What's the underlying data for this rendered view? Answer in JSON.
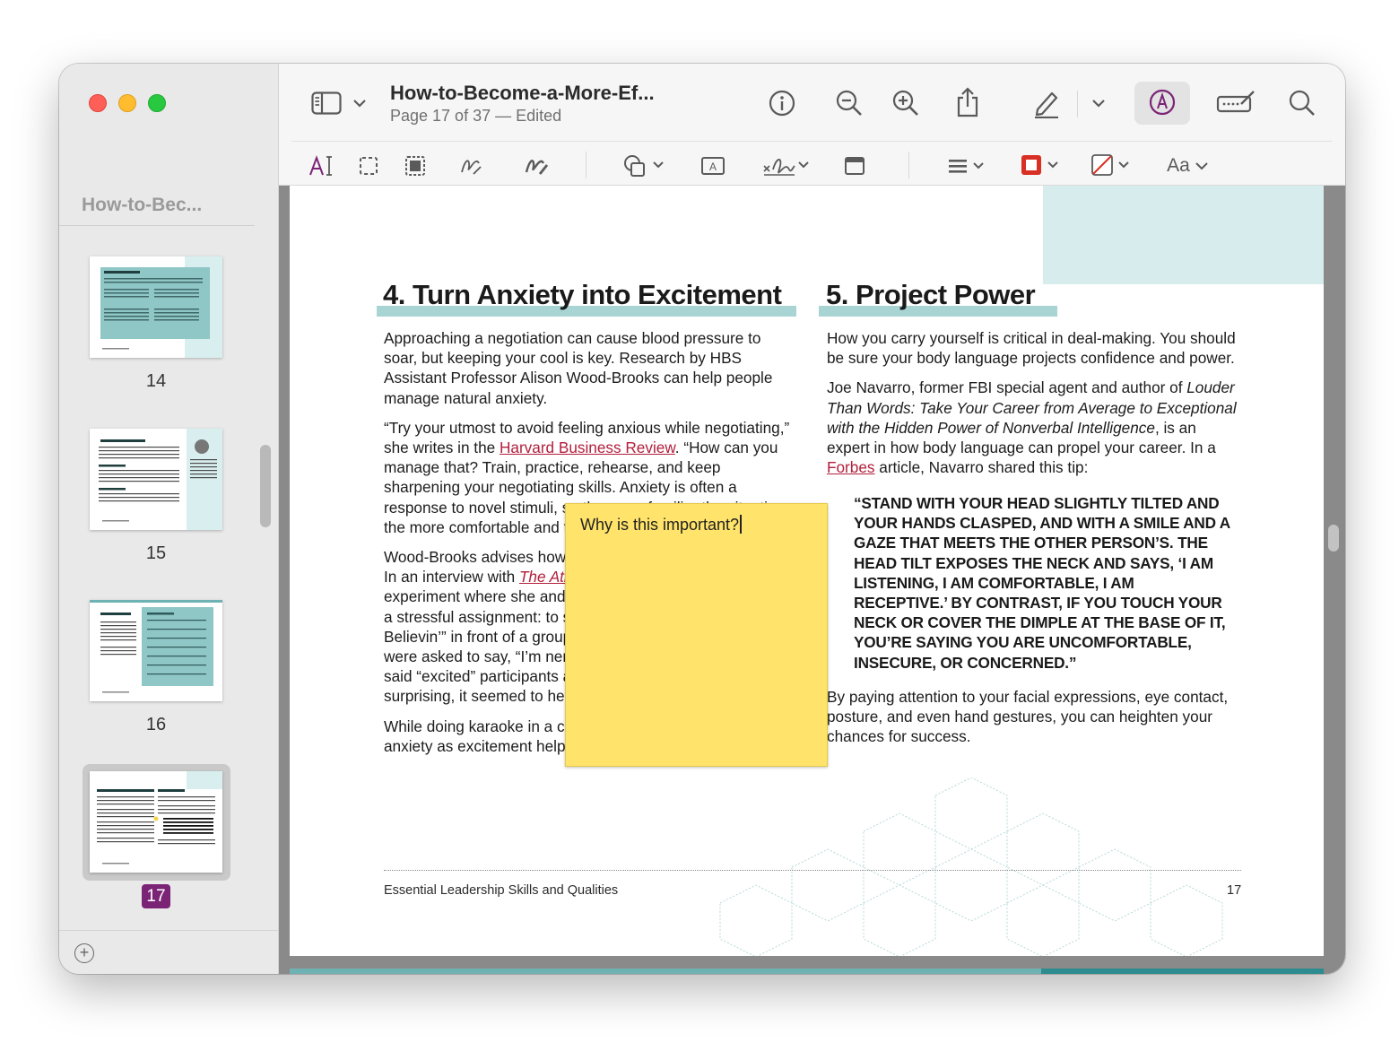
{
  "window": {
    "sidebar_title": "How-to-Bec...",
    "doc_title": "How-to-Become-a-More-Ef...",
    "doc_subtitle": "Page 17 of 37 — Edited"
  },
  "thumbnails": [
    {
      "page": "14",
      "selected": false
    },
    {
      "page": "15",
      "selected": false
    },
    {
      "page": "16",
      "selected": false
    },
    {
      "page": "17",
      "selected": true
    }
  ],
  "toolbar": {
    "top_icons": [
      "sidebar-icon",
      "chevron-down-icon",
      "info-icon",
      "zoom-out-icon",
      "zoom-in-icon",
      "share-icon",
      "highlight-pen-icon",
      "chevron-down-icon",
      "rotate-icon",
      "markup-icon",
      "form-fill-icon",
      "search-icon"
    ],
    "markup_icons": [
      "text-selection-icon",
      "rect-select-icon",
      "smart-lasso-icon",
      "sketch-icon",
      "draw-icon",
      "shapes-icon",
      "text-box-icon",
      "sign-icon",
      "note-icon",
      "shape-style-icon",
      "border-color-icon",
      "fill-color-icon"
    ],
    "font_label": "Aa",
    "text_tool_label": "A",
    "border_color": "#d93025",
    "active_color": "#7b2476"
  },
  "page": {
    "left_heading": "4. Turn Anxiety into Excitement",
    "right_heading": "5. Project Power",
    "left_p1": "Approaching a negotiation can cause blood pressure to soar, but keeping your cool is key. Research by HBS Assistant Professor Alison Wood-Brooks can help people manage natural anxiety.",
    "left_p2_a": "“Try your utmost to avoid feeling anxious while negotiating,” she writes in the ",
    "left_p2_link": "Harvard Business Review",
    "left_p2_b": ". “How can you manage that? Train, practice, rehearse, and keep sharpening your negotiating skills. Anxiety is often a response to novel stimuli, so the more familiar the situation, the more comfortable and the less anxious you’ll be.”",
    "left_p3_a": "Wood-Brooks advises how to reframe anxiety as excitement. In an interview with ",
    "left_p3_link": "The Atlantic",
    "left_p3_b": ", she described an experiment where she and her colleagues gave participants a stressful assignment: to sing Journey’s “Don’t Stop Believin’” in front of a group. Before they sang, participants were asked to say, “I’m nervous” or “I’m excited.” Those who said “excited” participants actually sang better. What’s more surprising, it seemed to help them relax.",
    "left_p4": "While doing karaoke in a crowded room, reframing your anxiety as excitement helps you maintain your composure.",
    "right_p1": "How you carry yourself is critical in deal-making. You should be sure your body language projects confidence and power.",
    "right_p2_a": "Joe Navarro, former FBI special agent and author of ",
    "right_p2_italic": "Louder Than Words: Take Your Career from Average to Exceptional with the Hidden Power of Nonverbal Intelligence",
    "right_p2_b": ", is an expert in how body language can propel your career. In a ",
    "right_p2_link": "Forbes",
    "right_p2_c": " article, Navarro shared this tip:",
    "quote": "“STAND WITH YOUR HEAD SLIGHTLY TILTED AND YOUR HANDS CLASPED, AND WITH A SMILE AND A GAZE THAT MEETS THE OTHER PERSON’S. THE HEAD TILT EXPOSES THE NECK AND SAYS, ‘I AM LISTENING, I AM COMFORTABLE, I AM RECEPTIVE.’ BY CONTRAST, IF YOU TOUCH YOUR NECK OR COVER THE DIMPLE AT THE BASE OF IT, YOU’RE SAYING YOU ARE UNCOMFORTABLE, INSECURE, OR CONCERNED.”",
    "right_p3": "By paying attention to your facial expressions, eye contact, posture, and even hand gestures, you can heighten your chances for success.",
    "footer_left": "Essential Leadership Skills and Qualities",
    "footer_right": "17"
  },
  "note": {
    "text": "Why is this important?",
    "color": "#ffe36a"
  }
}
